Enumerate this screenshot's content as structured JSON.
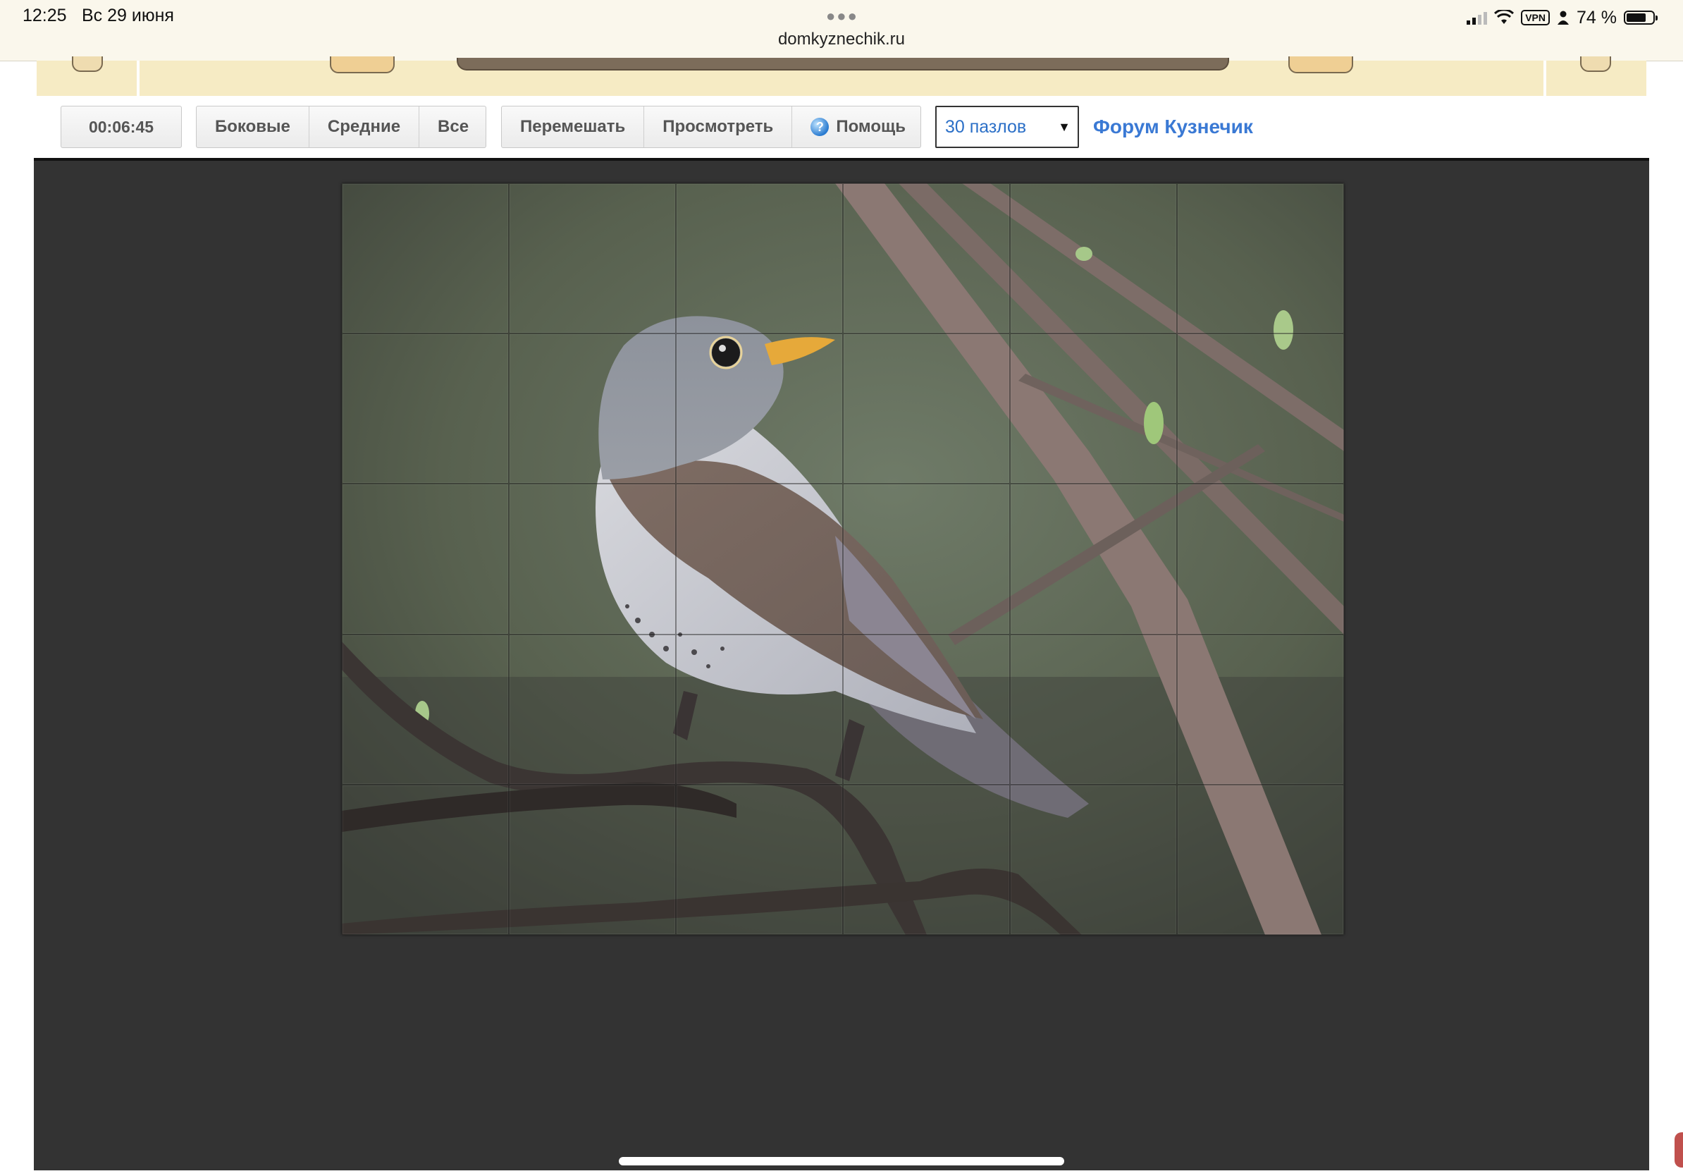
{
  "status_bar": {
    "time": "12:25",
    "date": "Вс 29 июня",
    "url": "domkyznechik.ru",
    "battery_text": "74 %",
    "battery_level": 0.74,
    "vpn_label": "VPN",
    "icons": [
      "cellular-signal-icon",
      "wifi-icon",
      "vpn-icon",
      "person-icon",
      "battery-icon"
    ]
  },
  "toolbar": {
    "timer": "00:06:45",
    "filters": [
      "Боковые",
      "Средние",
      "Все"
    ],
    "shuffle_label": "Перемешать",
    "preview_label": "Просмотреть",
    "help_label": "Помощь",
    "puzzle_count_selected": "30 пазлов",
    "forum_link": "Форум Кузнечик"
  },
  "puzzle": {
    "rows": 5,
    "cols": 6,
    "image_subject": "bird-on-branch",
    "colors": {
      "background": "#333333",
      "board_bg": "#5f6a5a",
      "bird_grey": "#8f939c",
      "bird_brown": "#7a6a62",
      "branch": "#8a7670",
      "beak": "#e6a93a"
    }
  }
}
